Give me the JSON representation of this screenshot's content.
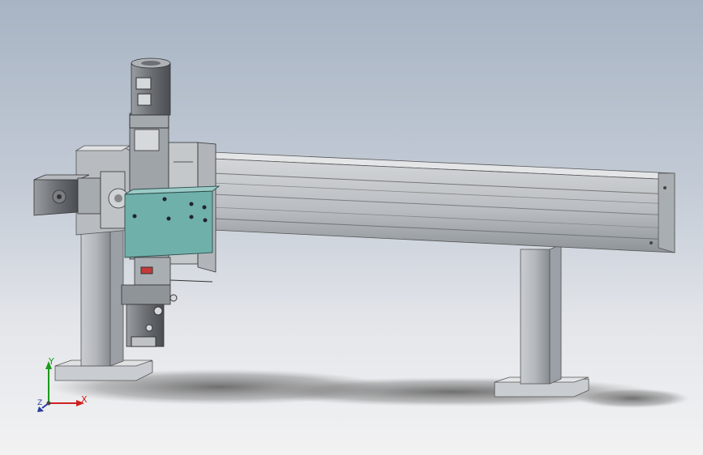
{
  "viewport": {
    "background_top": "#a8b4c4",
    "background_bottom": "#f2f2f3"
  },
  "model": {
    "description_icon": "gantry-linear-module",
    "colors": {
      "steel": "#b7bcc1",
      "steel_dark": "#8f959a",
      "steel_light": "#d6d9dc",
      "motor_dark": "#5b5f63",
      "plate_accent": "#6fb0ab",
      "shadow": "#6e6e6e"
    }
  },
  "triad": {
    "x_label": "X",
    "y_label": "Y",
    "z_label": "Z",
    "x_color": "#d02020",
    "y_color": "#1a9a1a",
    "z_color": "#2a3aa0"
  }
}
